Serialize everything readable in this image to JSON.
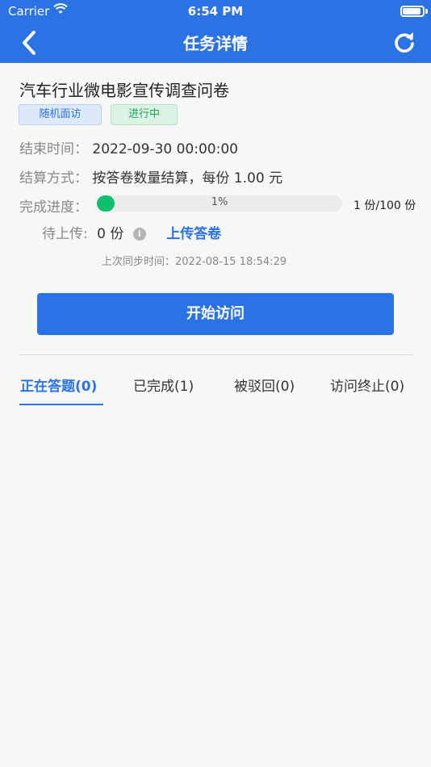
{
  "status_bar": {
    "carrier": "Carrier",
    "time": "6:54 PM"
  },
  "nav": {
    "title": "任务详情",
    "back_icon": "chevron-left-icon",
    "refresh_icon": "refresh-icon"
  },
  "task": {
    "title": "汽车行业微电影宣传调查问卷",
    "tags": [
      {
        "label": "随机面访",
        "color": "#2b73e5"
      },
      {
        "label": "进行中",
        "color": "#21a35a"
      }
    ],
    "end_time_label": "结束时间：",
    "end_time": "2022-09-30 00:00:00",
    "settle_label": "结算方式：",
    "settle_value": "按答卷数量结算，每份 1.00 元",
    "progress_label": "完成进度：",
    "progress_percent": 1,
    "progress_text": "1%",
    "progress_count": "1 份/100 份",
    "pending_label": "待上传:",
    "pending_value": "0 份",
    "upload_link": "上传答卷",
    "last_sync": "上次同步时间：2022-08-15 18:54:29"
  },
  "start_button": "开始访问",
  "tabs": [
    {
      "label": "正在答题(0)",
      "active": true
    },
    {
      "label": "已完成(1)",
      "active": false
    },
    {
      "label": "被驳回(0)",
      "active": false
    },
    {
      "label": "访问终止(0)",
      "active": false
    }
  ],
  "colors": {
    "primary": "#2b73e5",
    "progress": "#0fbf6c"
  }
}
